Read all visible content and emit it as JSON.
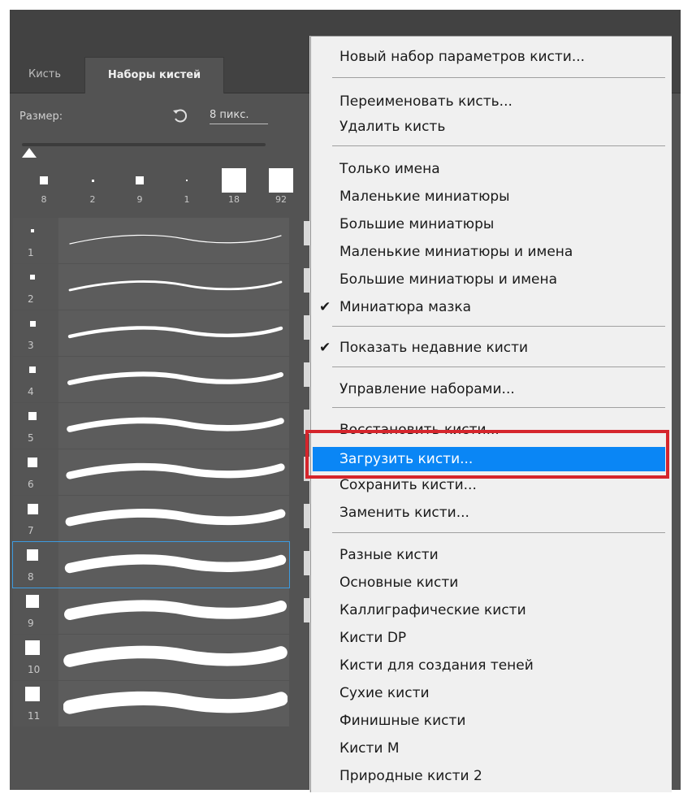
{
  "panel": {
    "tabs": [
      {
        "label": "Кисть"
      },
      {
        "label": "Наборы кистей"
      }
    ],
    "size_label": "Размер:",
    "size_value": "8 пикс.",
    "icons": {
      "reset": "reset-arrow-icon"
    },
    "slider_level": 0.0,
    "recent_brushes": [
      {
        "num": "8"
      },
      {
        "num": "2"
      },
      {
        "num": "9"
      },
      {
        "num": "1"
      },
      {
        "num": "18"
      },
      {
        "num": "92"
      }
    ],
    "brush_list": [
      {
        "num": "1"
      },
      {
        "num": "2"
      },
      {
        "num": "3"
      },
      {
        "num": "4"
      },
      {
        "num": "5"
      },
      {
        "num": "6"
      },
      {
        "num": "7"
      },
      {
        "num": "8"
      },
      {
        "num": "9"
      },
      {
        "num": "10"
      },
      {
        "num": "11"
      }
    ],
    "selected_brush": "8"
  },
  "menu": {
    "items": [
      {
        "label": "Новый набор параметров кисти..."
      },
      {
        "label": "Переименовать кисть..."
      },
      {
        "label": "Удалить кисть"
      },
      {
        "label": "Только имена"
      },
      {
        "label": "Маленькие миниатюры"
      },
      {
        "label": "Большие миниатюры"
      },
      {
        "label": "Маленькие миниатюры и имена"
      },
      {
        "label": "Большие миниатюры и имена"
      },
      {
        "label": "Миниатюра мазка",
        "checked": true,
        "check": "✔"
      },
      {
        "label": "Показать недавние кисти",
        "checked": true,
        "check": "✔"
      },
      {
        "label": "Управление наборами..."
      },
      {
        "label": "Восстановить кисти..."
      },
      {
        "label": "Загрузить кисти...",
        "highlighted": true
      },
      {
        "label": "Сохранить кисти..."
      },
      {
        "label": "Заменить кисти..."
      },
      {
        "label": "Разные кисти"
      },
      {
        "label": "Основные кисти"
      },
      {
        "label": "Каллиграфические кисти"
      },
      {
        "label": "Кисти DP"
      },
      {
        "label": "Кисти для создания теней"
      },
      {
        "label": "Сухие кисти"
      },
      {
        "label": "Финишные кисти"
      },
      {
        "label": "Кисти M"
      },
      {
        "label": "Природные кисти 2"
      }
    ],
    "highlight_color": "#0a86f5",
    "annotation_color": "#d5252c"
  }
}
